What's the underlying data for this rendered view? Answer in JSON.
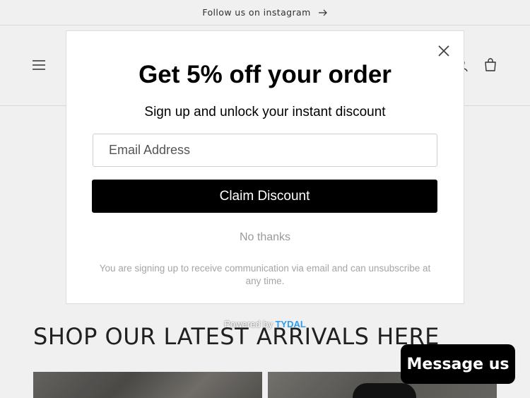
{
  "announcement": {
    "text": "Follow us on instagram"
  },
  "section": {
    "heading": "SHOP OUR LATEST ARRIVALS HERE"
  },
  "popup": {
    "title": "Get 5% off your order",
    "subtitle": "Sign up and unlock your instant discount",
    "email_placeholder": "Email Address",
    "claim_label": "Claim Discount",
    "no_thanks_label": "No thanks",
    "disclaimer": "You are signing up to receive communication via email and can unsubscribe at any time."
  },
  "powered_by": {
    "prefix": "Powered by",
    "brand": "TYDAL",
    "brand_color": "#2f9cf0"
  },
  "chat": {
    "label": "Message us"
  },
  "icons": {
    "menu": "hamburger-menu-icon",
    "account": "account-icon",
    "cart": "cart-icon",
    "close": "close-icon",
    "arrow": "arrow-right-icon"
  }
}
